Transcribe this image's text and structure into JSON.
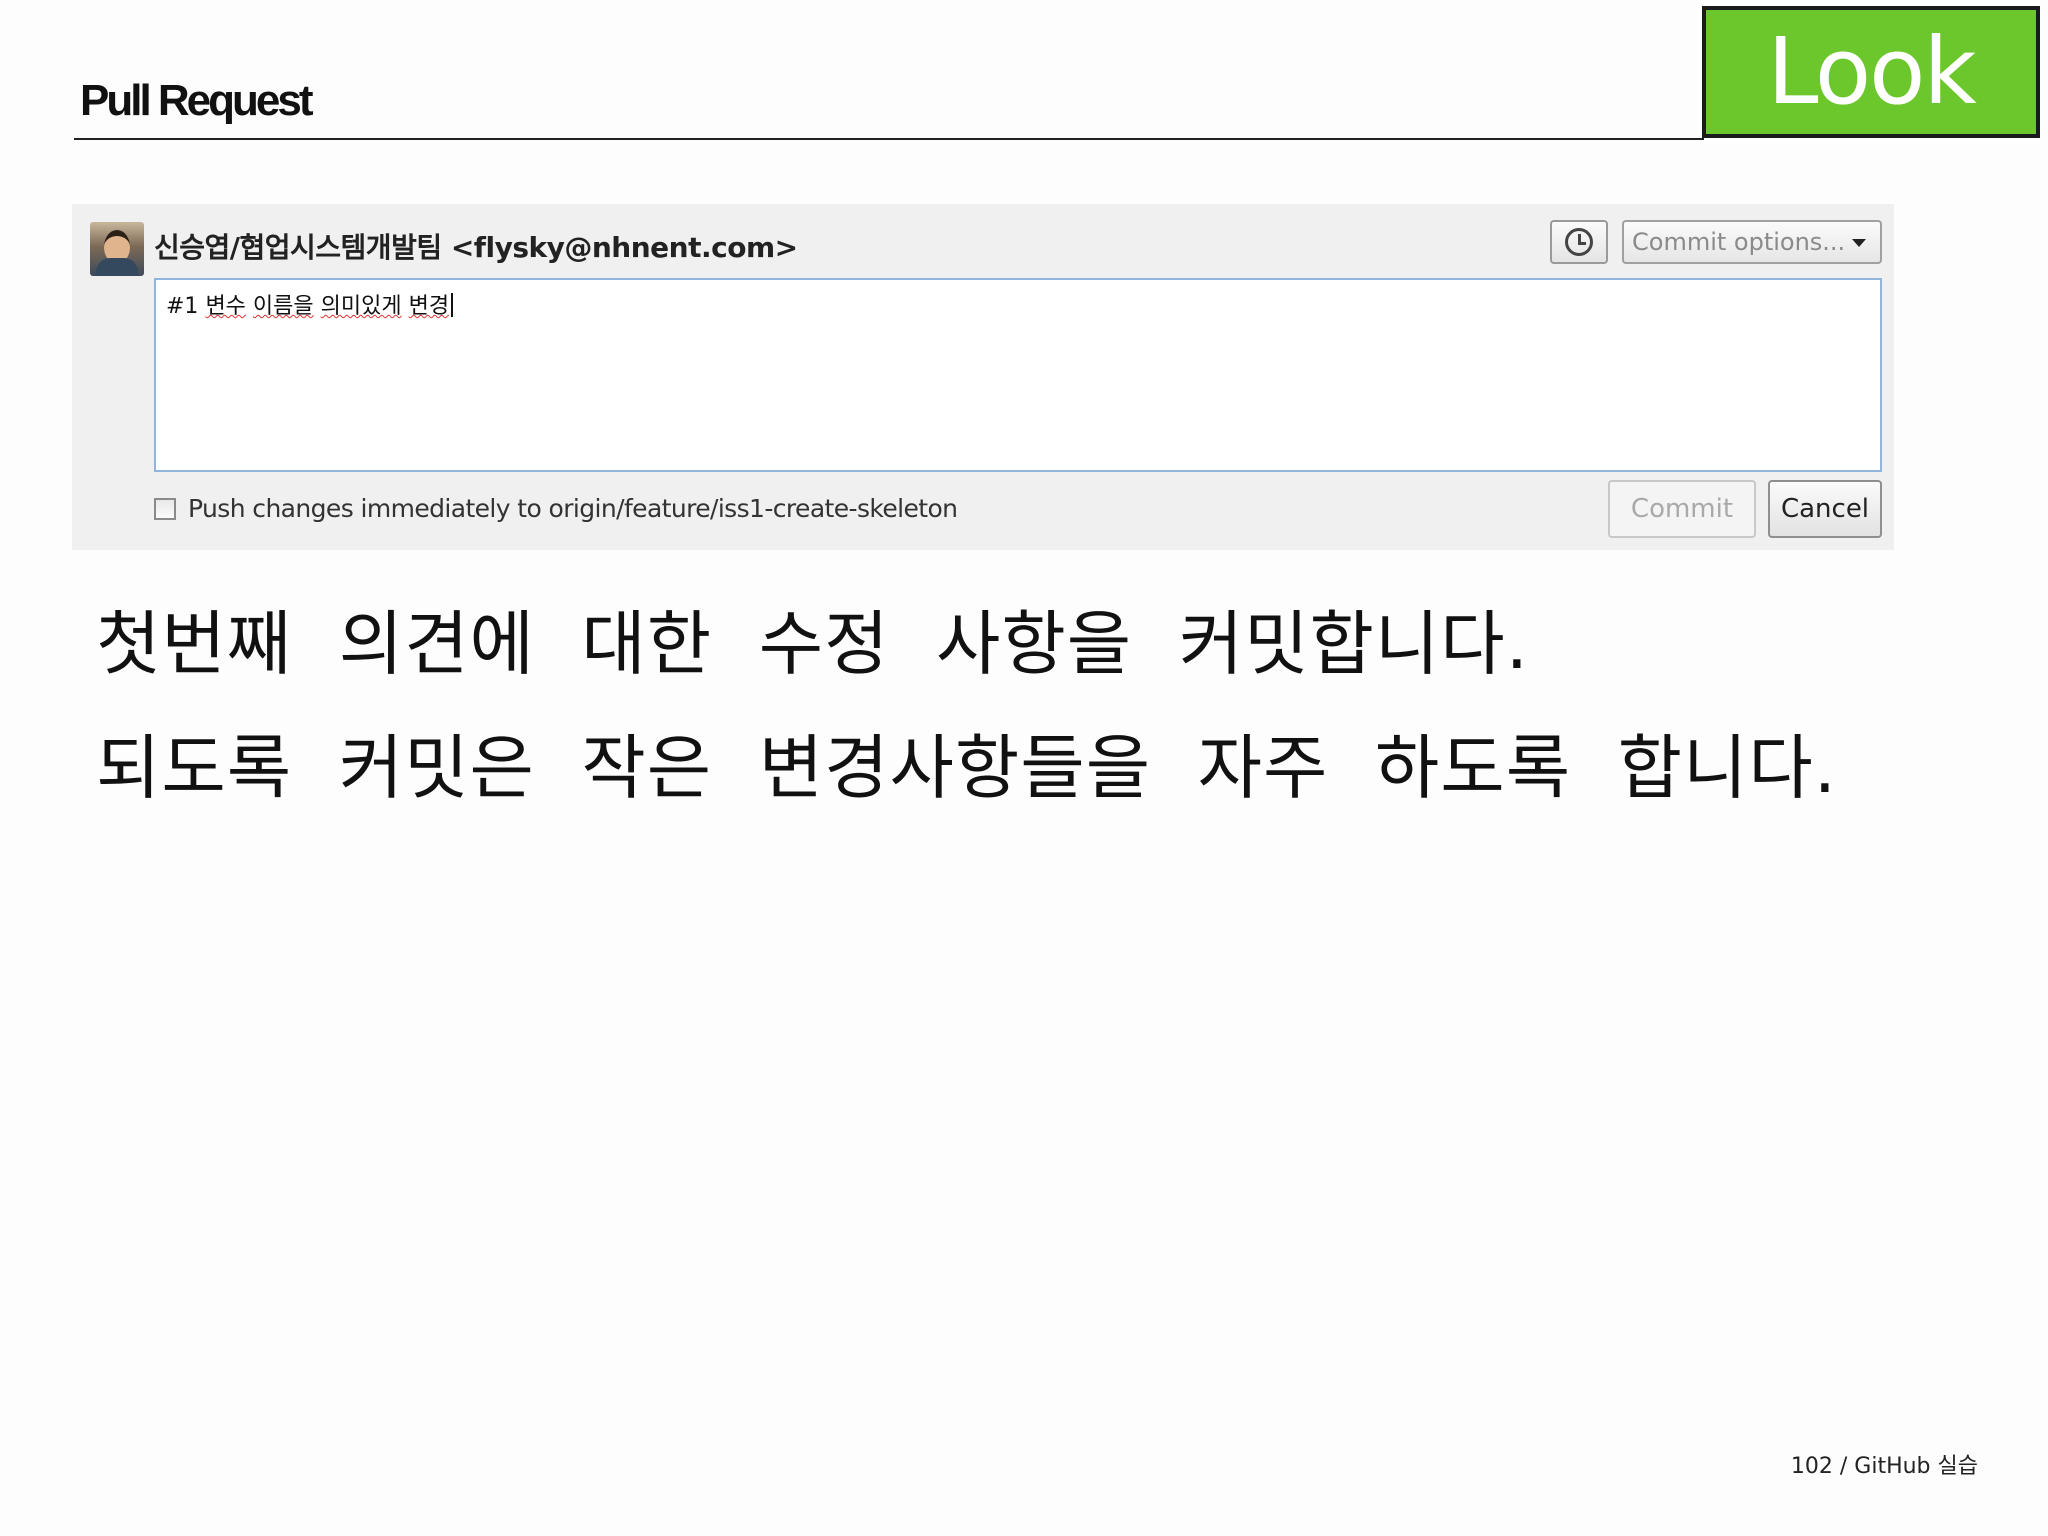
{
  "slide": {
    "title": "Pull Request",
    "badge": "Look",
    "footer": "102 / GitHub 실습"
  },
  "commit_panel": {
    "author": "신승엽/협업시스템개발팀 <flysky@nhnent.com>",
    "history_icon": "clock-icon",
    "commit_options_label": "Commit options...",
    "message": {
      "prefix": "#1 ",
      "words": [
        "변수",
        "이름을",
        "의미있게",
        "변경"
      ]
    },
    "push_checkbox_checked": false,
    "push_label": "Push changes immediately to origin/feature/iss1-create-skeleton",
    "commit_label": "Commit",
    "cancel_label": "Cancel"
  },
  "body_text": {
    "line1": "첫번째  의견에  대한  수정  사항을  커밋합니다.",
    "line2": "되도록  커밋은  작은  변경사항들을  자주  하도록  합니다."
  },
  "colors": {
    "badge_green": "#6cc72c",
    "panel_gray": "#f0f0f0",
    "message_border": "#8fb5dc"
  }
}
